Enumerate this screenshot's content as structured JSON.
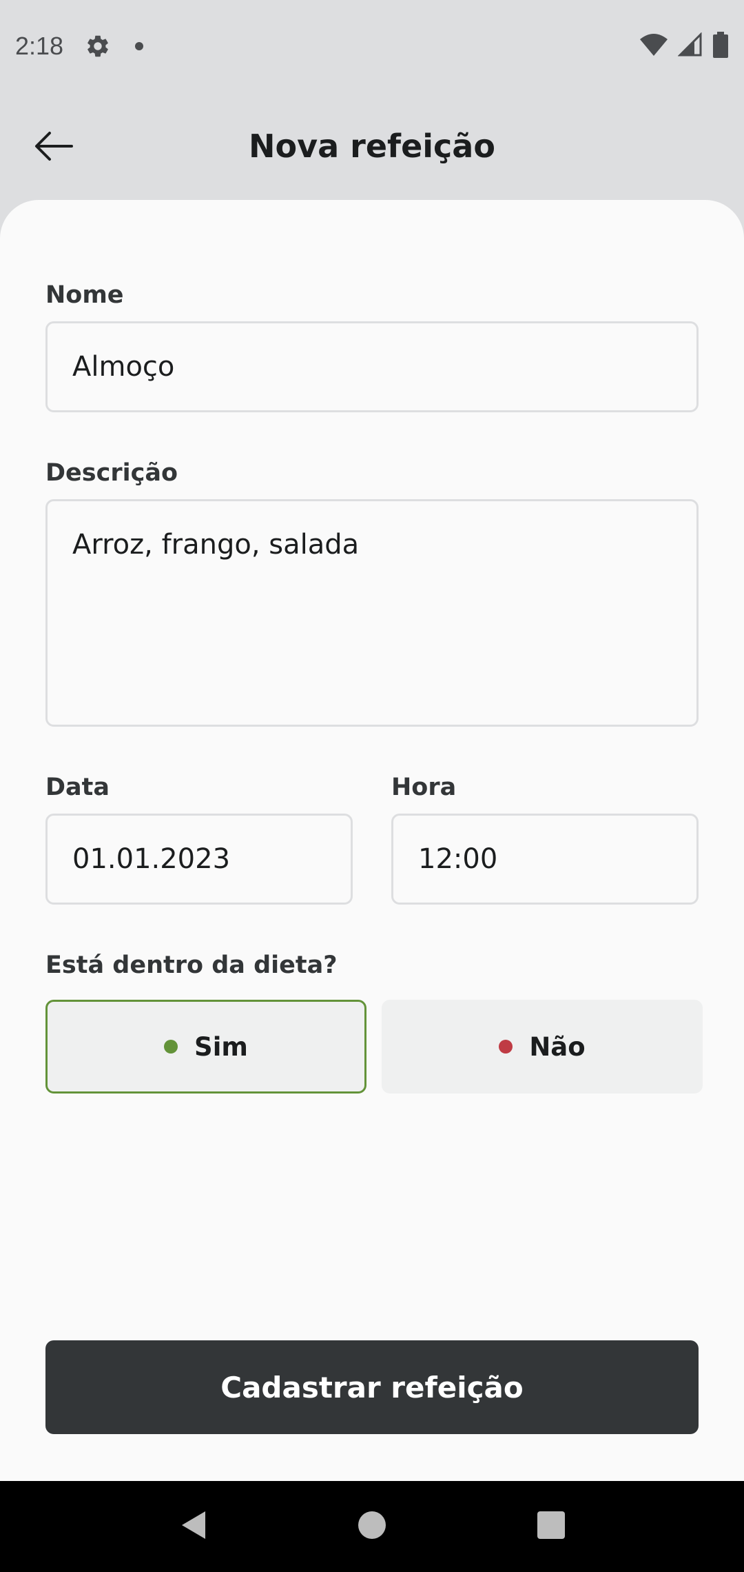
{
  "status_bar": {
    "time": "2:18",
    "icons": [
      "gear-icon",
      "notification-dot-icon",
      "wifi-icon",
      "cell-signal-icon",
      "battery-icon"
    ]
  },
  "header": {
    "title": "Nova refeição",
    "back_icon": "arrow-left-icon"
  },
  "form": {
    "name": {
      "label": "Nome",
      "value": "Almoço"
    },
    "description": {
      "label": "Descrição",
      "value": "Arroz, frango, salada"
    },
    "date": {
      "label": "Data",
      "value": "01.01.2023"
    },
    "time": {
      "label": "Hora",
      "value": "12:00"
    },
    "diet_question": {
      "label": "Está dentro da dieta?",
      "options": [
        {
          "label": "Sim",
          "selected": true,
          "dot_color": "#639339"
        },
        {
          "label": "Não",
          "selected": false,
          "dot_color": "#bf3b44"
        }
      ]
    },
    "submit_label": "Cadastrar refeição"
  },
  "colors": {
    "background": "#dddee0",
    "card": "#fafafa",
    "button": "#333638",
    "green": "#639339",
    "red": "#bf3b44"
  },
  "nav_bar": {
    "icons": [
      "nav-back-icon",
      "nav-home-icon",
      "nav-recents-icon"
    ]
  }
}
